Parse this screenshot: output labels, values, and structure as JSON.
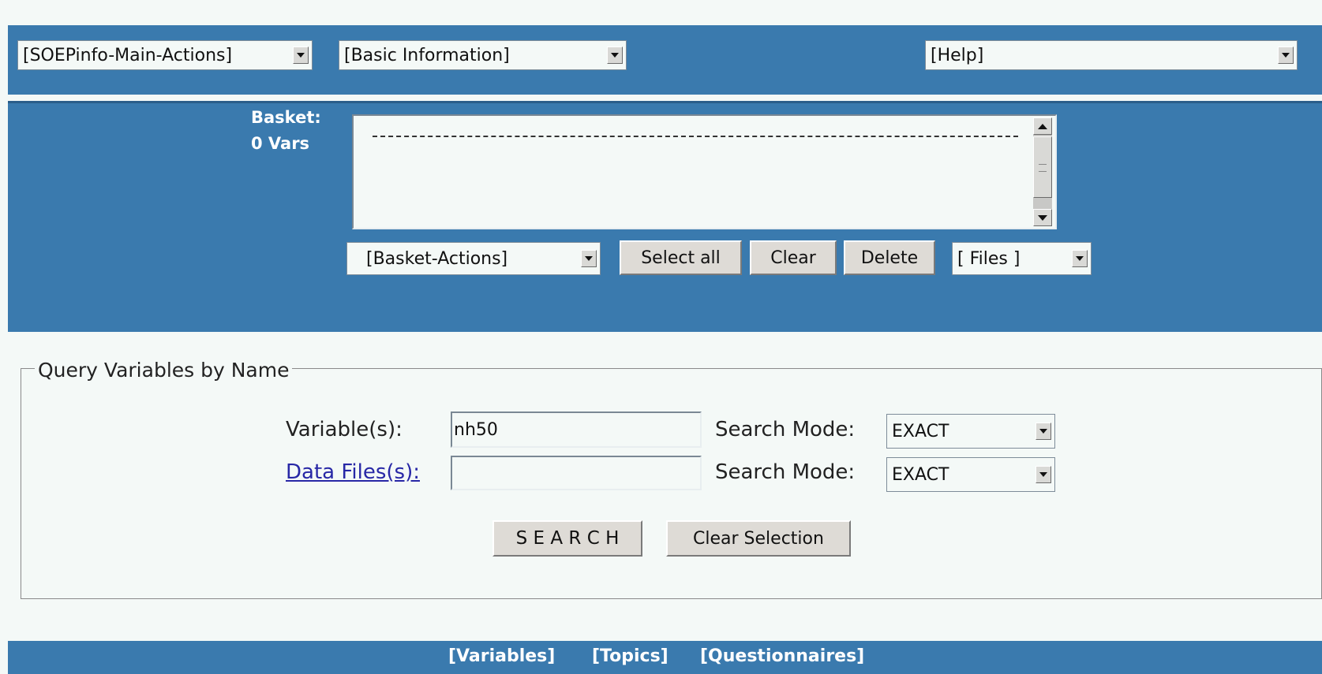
{
  "top_bar": {
    "main_actions": "[SOEPinfo-Main-Actions]",
    "basic_information": "[Basic Information]",
    "help": "[Help]"
  },
  "basket": {
    "label": "Basket:",
    "count": "0 Vars",
    "actions_select": "[Basket-Actions]",
    "select_all": "Select all",
    "clear": "Clear",
    "delete": "Delete",
    "files_select": "[ Files ]"
  },
  "query": {
    "legend": "Query Variables by Name",
    "variables_label": "Variable(s):",
    "variables_value": "nh50",
    "datafiles_label": "Data Files(s):",
    "datafiles_value": "",
    "search_mode_label": "Search Mode:",
    "search_mode_1": "EXACT",
    "search_mode_2": "EXACT",
    "search_button": "S E A R C H",
    "clear_selection_button": "Clear Selection"
  },
  "footer": {
    "links": [
      "[Variables]",
      "[Topics]",
      "[Questionnaires]"
    ]
  }
}
